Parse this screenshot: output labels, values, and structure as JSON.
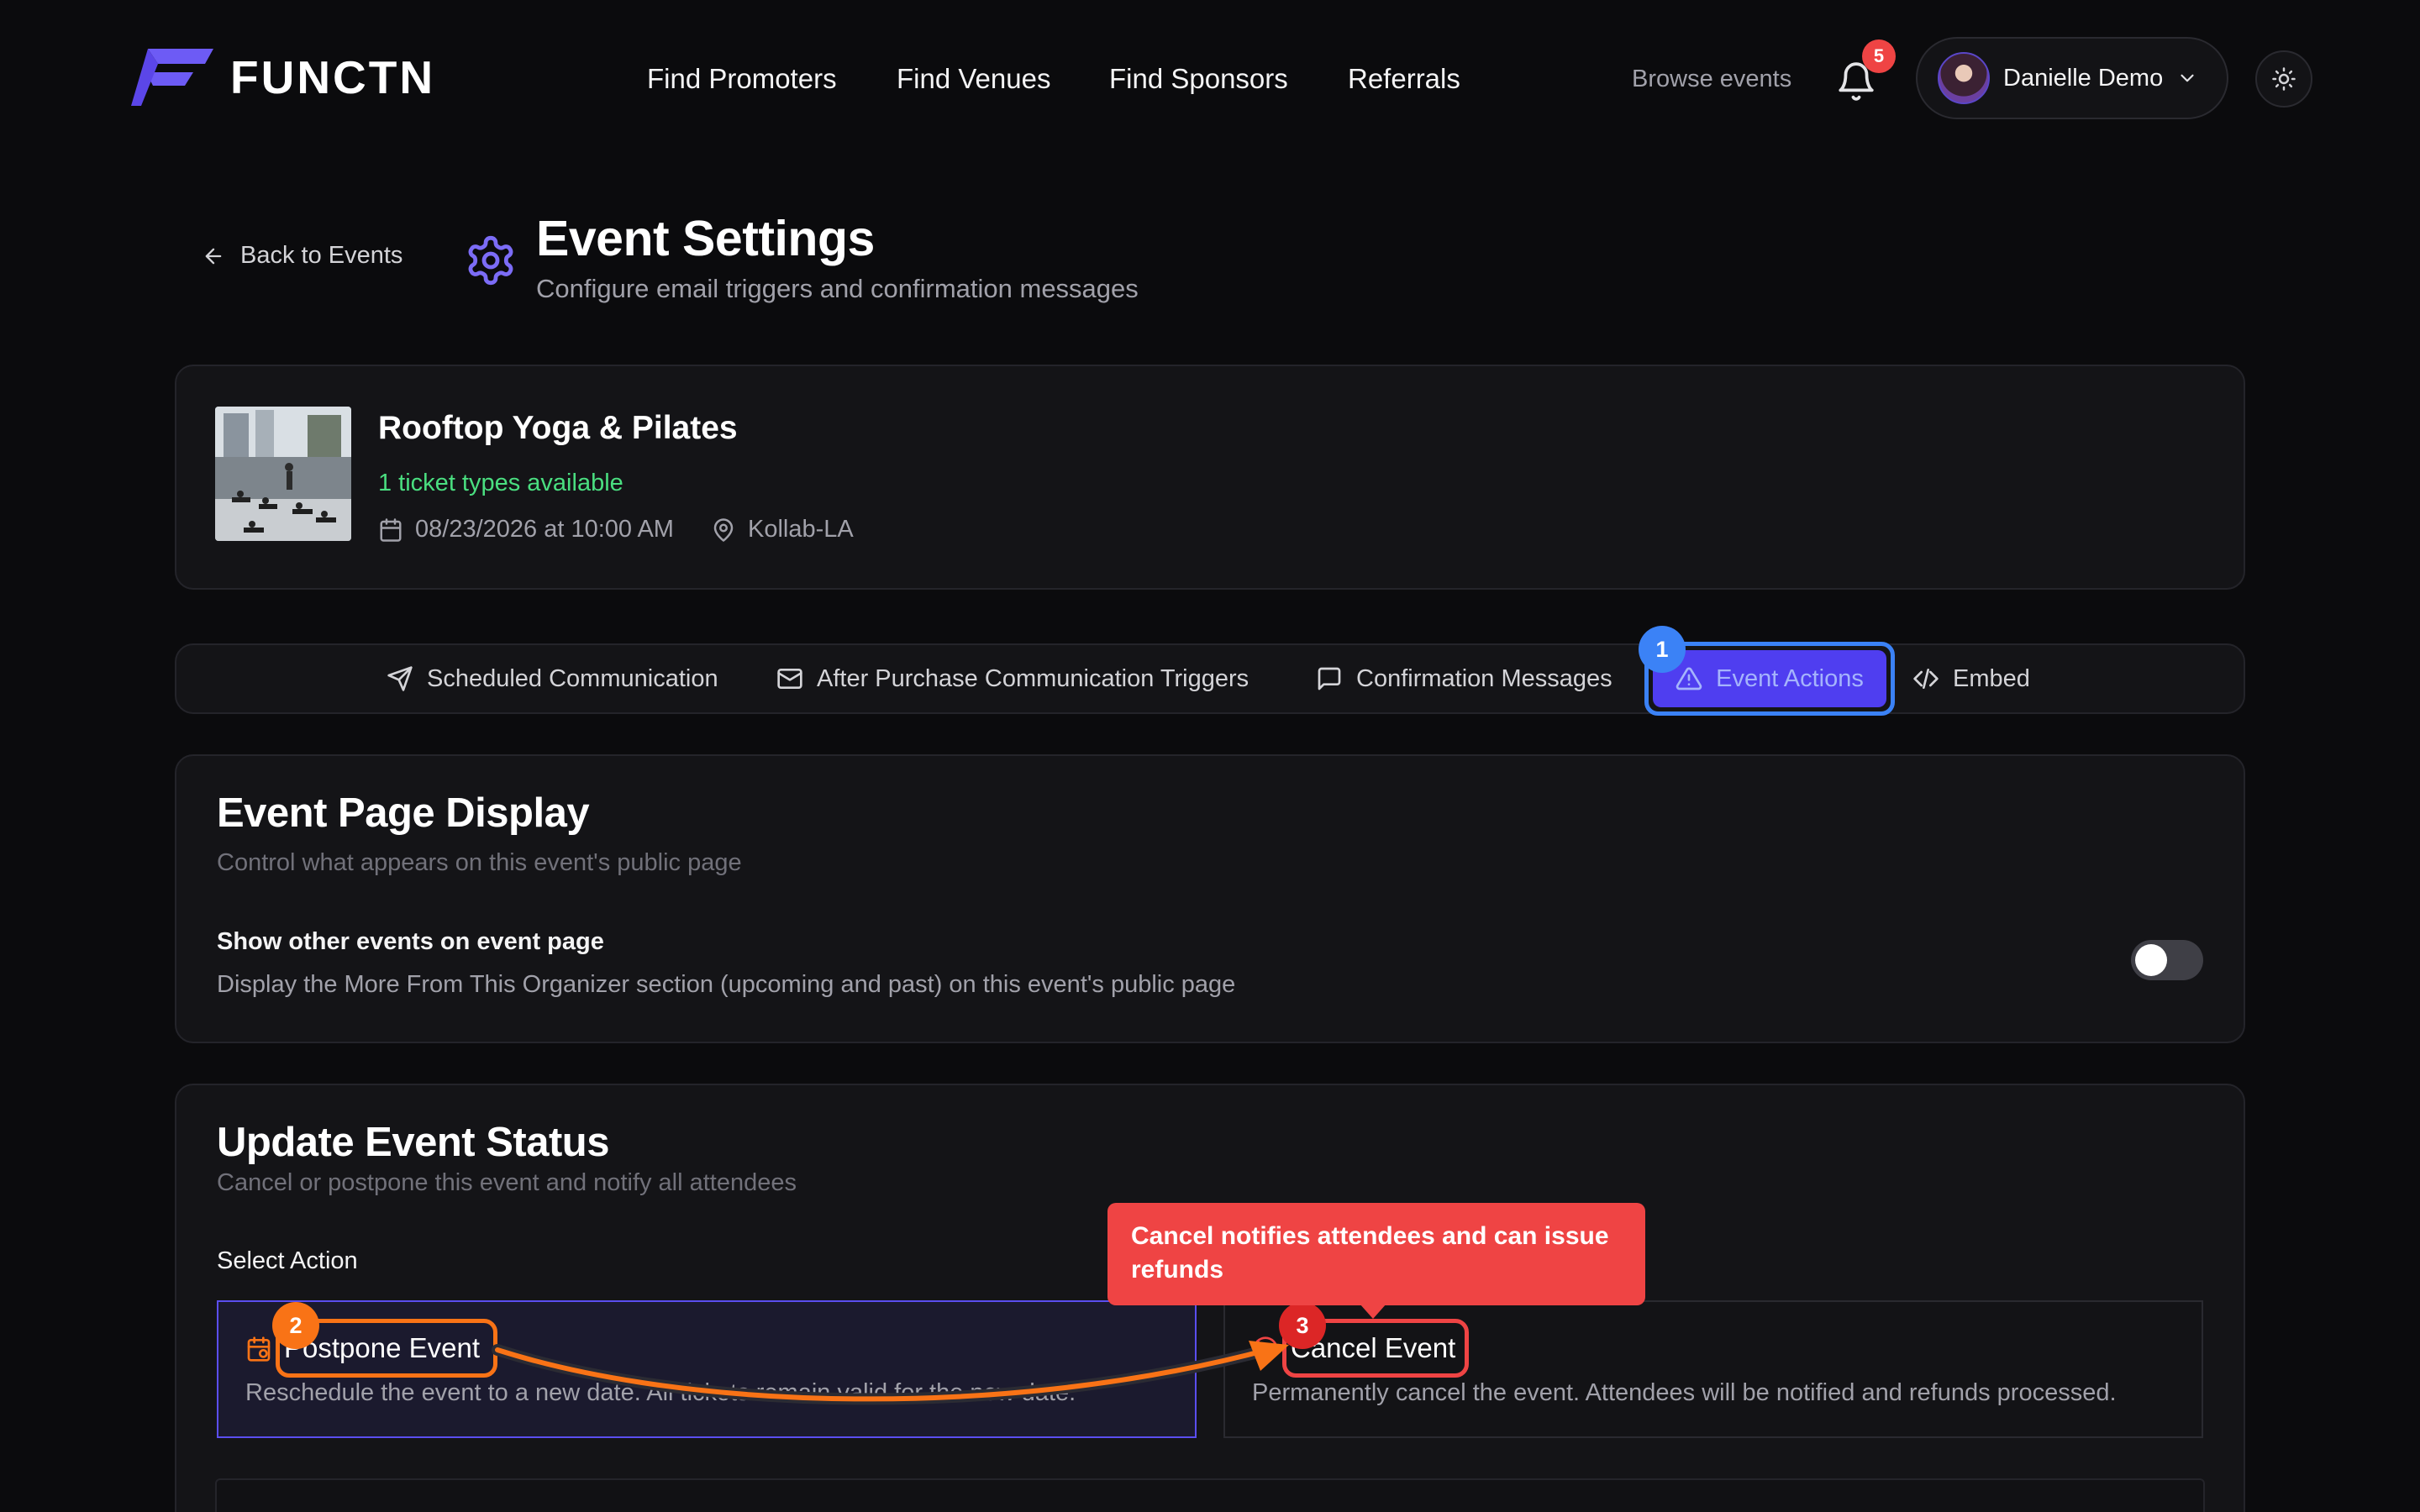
{
  "nav": {
    "logo_text": "FUNCTN",
    "links": [
      "Find Promoters",
      "Find Venues",
      "Find Sponsors",
      "Referrals"
    ],
    "browse": "Browse events",
    "notification_count": "5",
    "user_name": "Danielle Demo"
  },
  "header": {
    "back": "Back to Events",
    "title": "Event Settings",
    "subtitle": "Configure email triggers and confirmation messages"
  },
  "event": {
    "name": "Rooftop Yoga & Pilates",
    "ticket_types": "1 ticket types available",
    "datetime": "08/23/2026 at 10:00 AM",
    "location": "Kollab-LA"
  },
  "tabs": {
    "scheduled": "Scheduled Communication",
    "after_purchase": "After Purchase Communication Triggers",
    "confirmation": "Confirmation Messages",
    "actions": "Event Actions",
    "embed": "Embed"
  },
  "display_section": {
    "title": "Event Page Display",
    "subtitle": "Control what appears on this event's public page",
    "setting_label": "Show other events on event page",
    "setting_desc": "Display the More From This Organizer section (upcoming and past) on this event's public page",
    "toggle_on": false
  },
  "status_section": {
    "title": "Update Event Status",
    "subtitle": "Cancel or postpone this event and notify all attendees",
    "select_label": "Select Action",
    "postpone_title": "Postpone Event",
    "postpone_desc": "Reschedule the event to a new date. All tickets remain valid for the new date.",
    "cancel_title": "Cancel Event",
    "cancel_desc": "Permanently cancel the event. Attendees will be notified and refunds processed."
  },
  "annotations": {
    "step1": "1",
    "step2": "2",
    "step3": "3",
    "tooltip": "Cancel notifies attendees and can issue refunds"
  },
  "colors": {
    "accent": "#4f3ef0",
    "highlight_blue": "#3b82f6",
    "highlight_orange": "#f97316",
    "highlight_red": "#ef4444",
    "success": "#4ade80"
  }
}
